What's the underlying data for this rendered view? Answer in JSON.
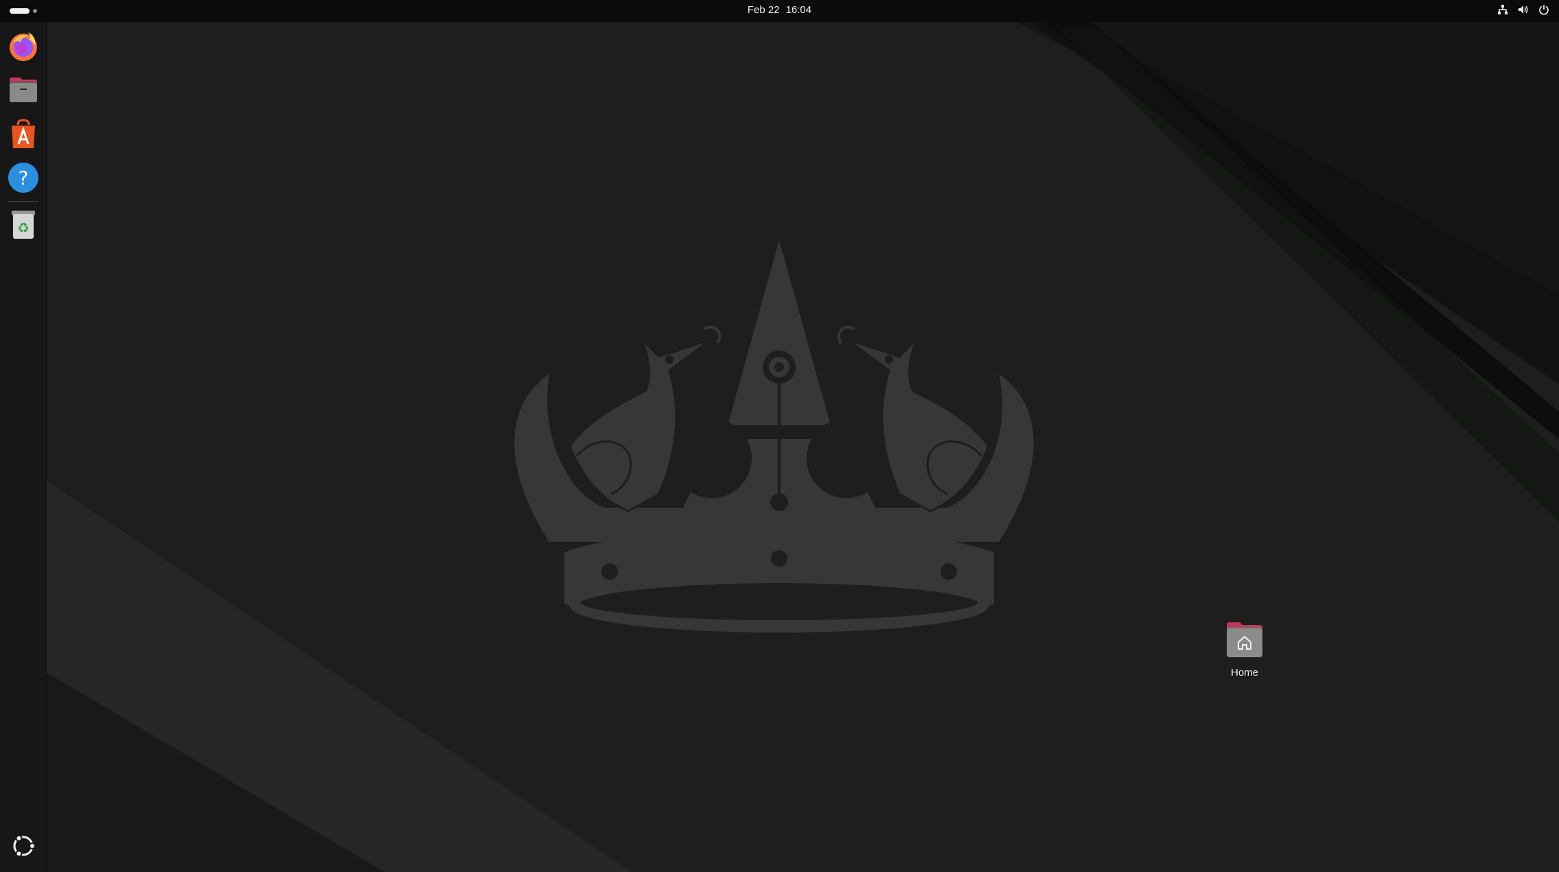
{
  "topbar": {
    "activities_icon": "activities-indicator",
    "clock": {
      "date": "Feb 22",
      "time": "16:04"
    },
    "tray_icons": [
      "network-wired-icon",
      "volume-icon",
      "power-icon"
    ]
  },
  "dock": {
    "apps": [
      {
        "name": "Firefox",
        "icon": "firefox-icon"
      },
      {
        "name": "Files",
        "icon": "files-icon"
      },
      {
        "name": "App Center",
        "icon": "app-center-icon"
      },
      {
        "name": "Help",
        "icon": "help-icon"
      },
      {
        "name": "Trash",
        "icon": "trash-icon"
      }
    ],
    "show_apps_icon": "ubuntu-logo-icon"
  },
  "desktop": {
    "icons": [
      {
        "label": "Home",
        "icon": "home-folder-icon"
      }
    ]
  },
  "colors": {
    "topbar_bg": "#0b0b0b",
    "dock_bg": "#161716",
    "wallpaper_bg": "#1e1f1e",
    "crown": "#383938",
    "firefox_orange": "#ff7139",
    "app_center_orange": "#e95420",
    "help_blue": "#2a8fe0",
    "folder_accent": "#c7365f"
  }
}
